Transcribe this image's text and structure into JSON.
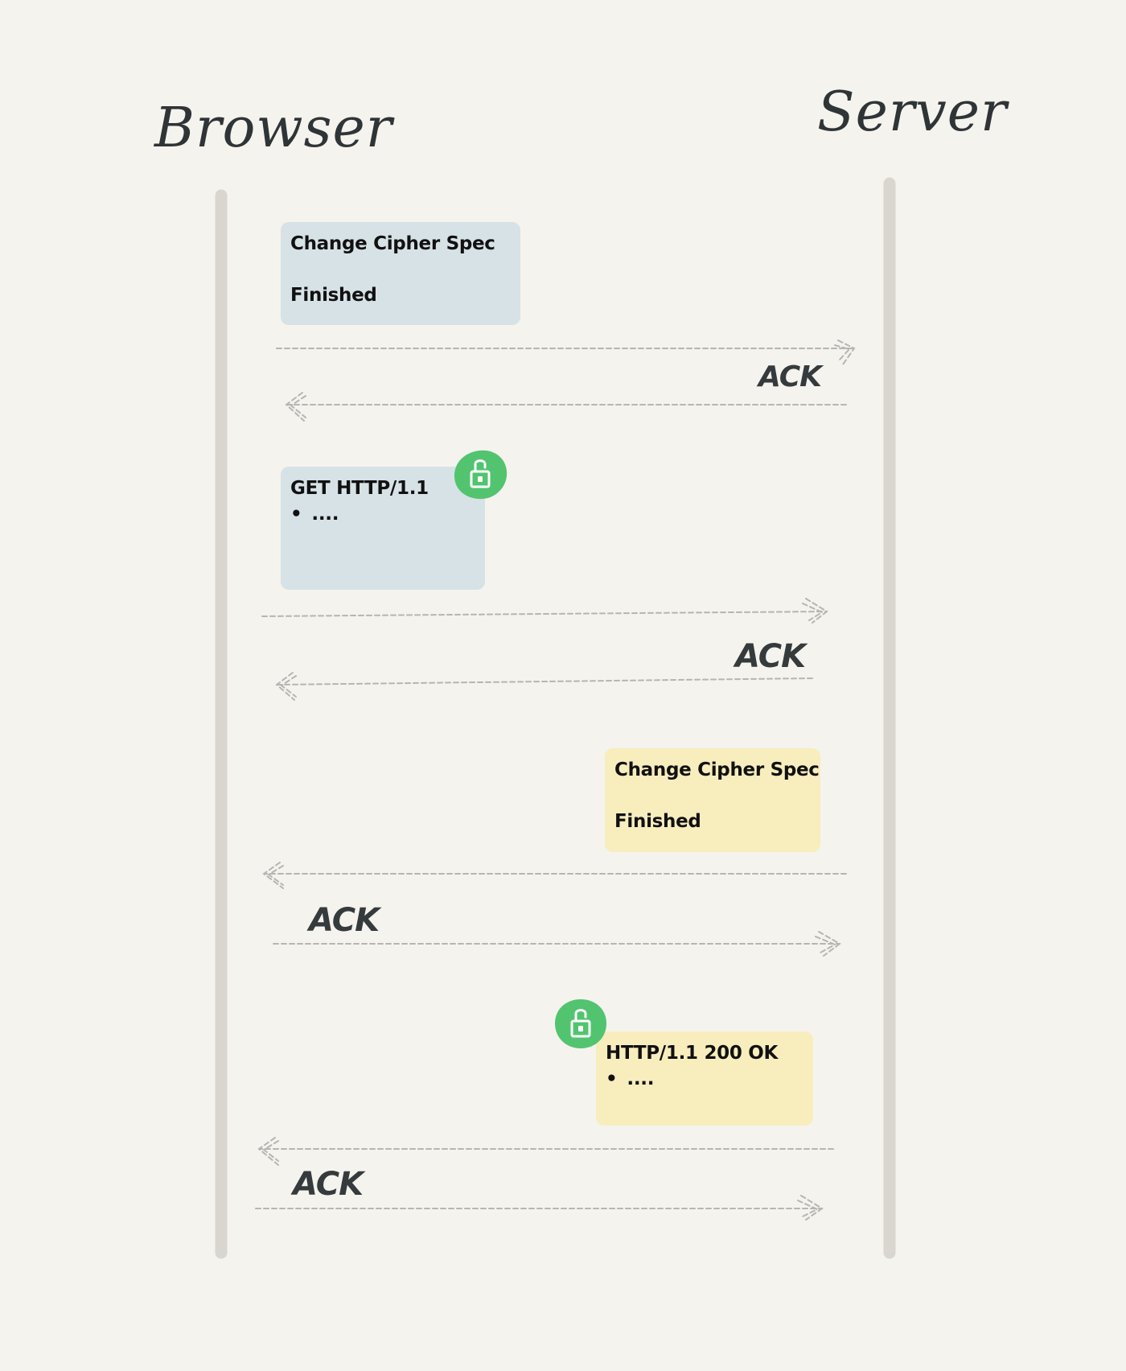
{
  "actors": {
    "browser": "Browser",
    "server": "Server"
  },
  "messages": [
    {
      "from": "Browser",
      "to": "Server",
      "lines": [
        "Change Cipher Spec",
        "Finished"
      ],
      "color": "#d7e2e6",
      "encrypted": false
    },
    {
      "from": "Browser",
      "to": "Server",
      "title": "GET HTTP/1.1",
      "bullet": "....",
      "color": "#d7e2e6",
      "encrypted": true
    },
    {
      "from": "Server",
      "to": "Browser",
      "lines": [
        "Change Cipher Spec",
        "Finished"
      ],
      "color": "#f8edbd",
      "encrypted": false
    },
    {
      "from": "Server",
      "to": "Browser",
      "title": "HTTP/1.1 200 OK",
      "bullet": "....",
      "color": "#f8edbd",
      "encrypted": true
    }
  ],
  "acks": [
    "ACK",
    "ACK",
    "ACK",
    "ACK"
  ],
  "icons": {
    "lock": "lock-icon",
    "lock_color": "#52c46f"
  },
  "colors": {
    "background": "#f5f3ee",
    "lifeline": "#d9d6d0",
    "arrow": "#b7b5b1",
    "text": "#2f3436"
  }
}
